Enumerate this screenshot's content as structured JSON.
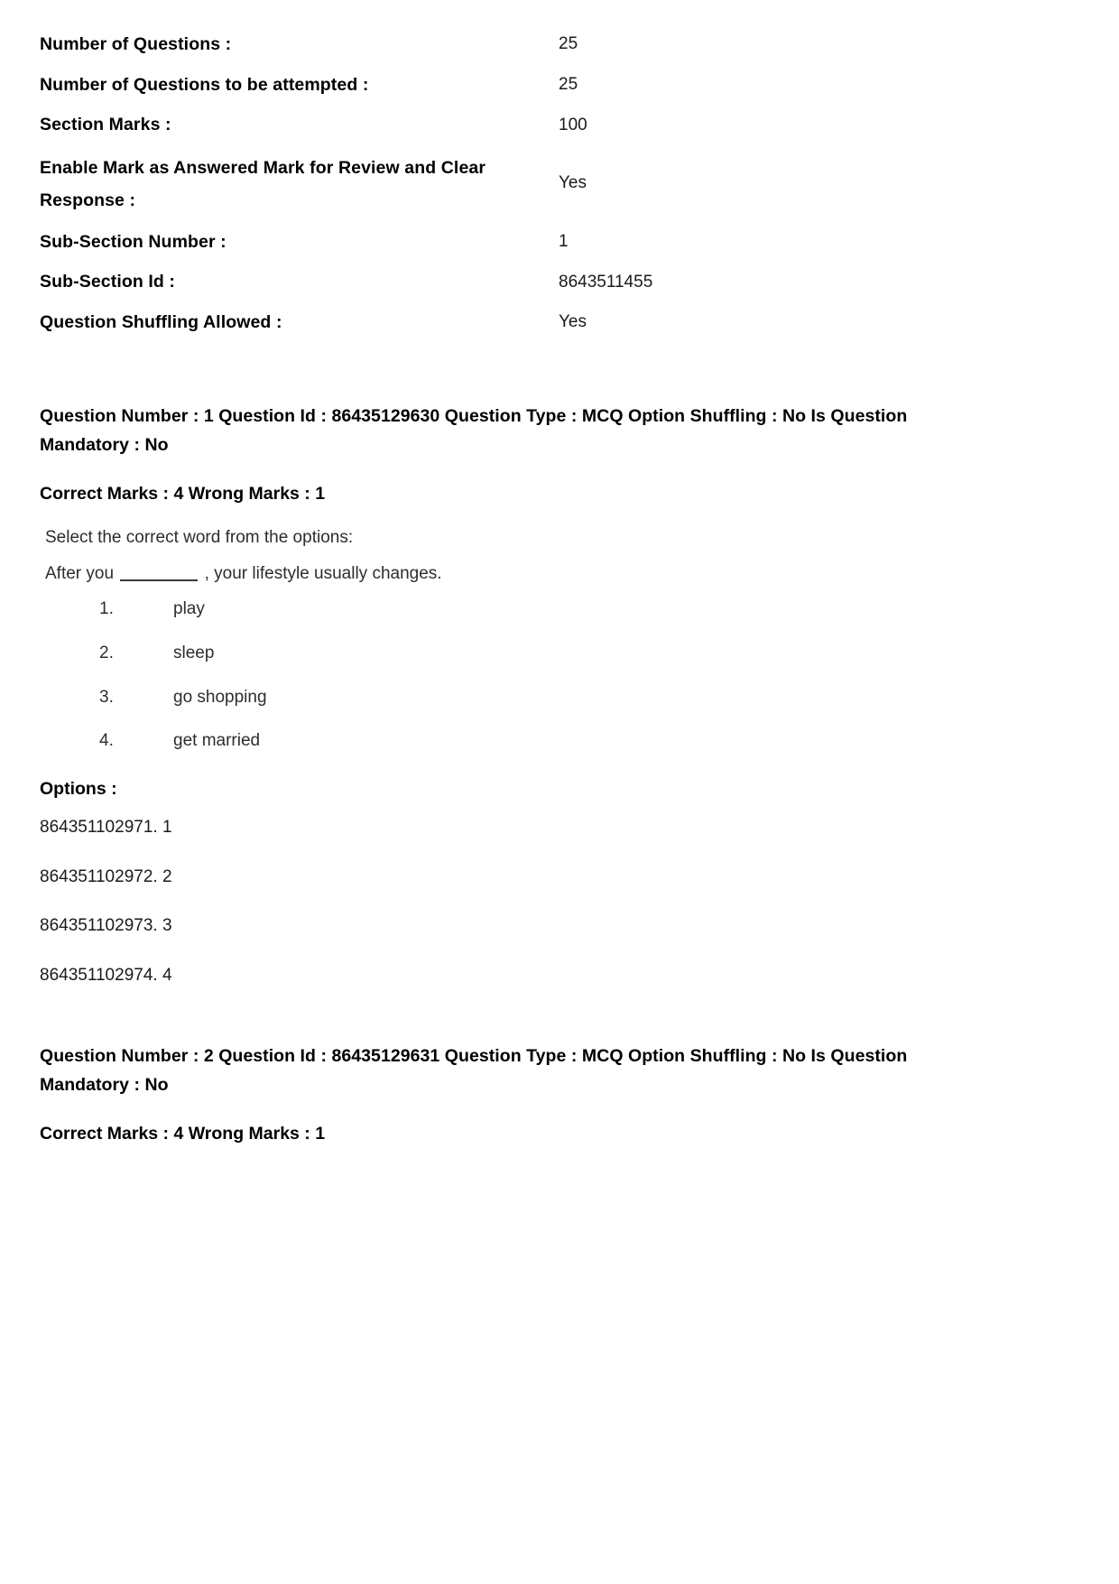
{
  "section_meta": {
    "rows": [
      {
        "label": "Number of Questions :",
        "value": "25",
        "wrap": false
      },
      {
        "label": "Number of Questions to be attempted :",
        "value": "25",
        "wrap": false
      },
      {
        "label": "Section Marks :",
        "value": "100",
        "wrap": false
      },
      {
        "label": "Enable Mark as Answered Mark for Review and Clear Response :",
        "value": "Yes",
        "wrap": true
      },
      {
        "label": "Sub-Section Number :",
        "value": "1",
        "wrap": false
      },
      {
        "label": "Sub-Section Id :",
        "value": "8643511455",
        "wrap": false
      },
      {
        "label": "Question Shuffling Allowed :",
        "value": "Yes",
        "wrap": false
      }
    ]
  },
  "questions": [
    {
      "header": "Question Number : 1 Question Id : 86435129630 Question Type : MCQ Option Shuffling : No Is Question Mandatory : No",
      "marks": "Correct Marks : 4 Wrong Marks : 1",
      "body": {
        "instruction": "Select the correct word from the options:",
        "stem_before_blank": "After you",
        "stem_after_blank": ", your lifestyle usually changes.",
        "choices": [
          {
            "num": "1.",
            "text": "play"
          },
          {
            "num": "2.",
            "text": "sleep"
          },
          {
            "num": "3.",
            "text": "go shopping"
          },
          {
            "num": "4.",
            "text": "get married"
          }
        ]
      },
      "options_title": "Options :",
      "options": [
        "864351102971. 1",
        "864351102972. 2",
        "864351102973. 3",
        "864351102974. 4"
      ]
    },
    {
      "header": "Question Number : 2 Question Id : 86435129631 Question Type : MCQ Option Shuffling : No Is Question Mandatory : No",
      "marks": "Correct Marks : 4 Wrong Marks : 1"
    }
  ]
}
